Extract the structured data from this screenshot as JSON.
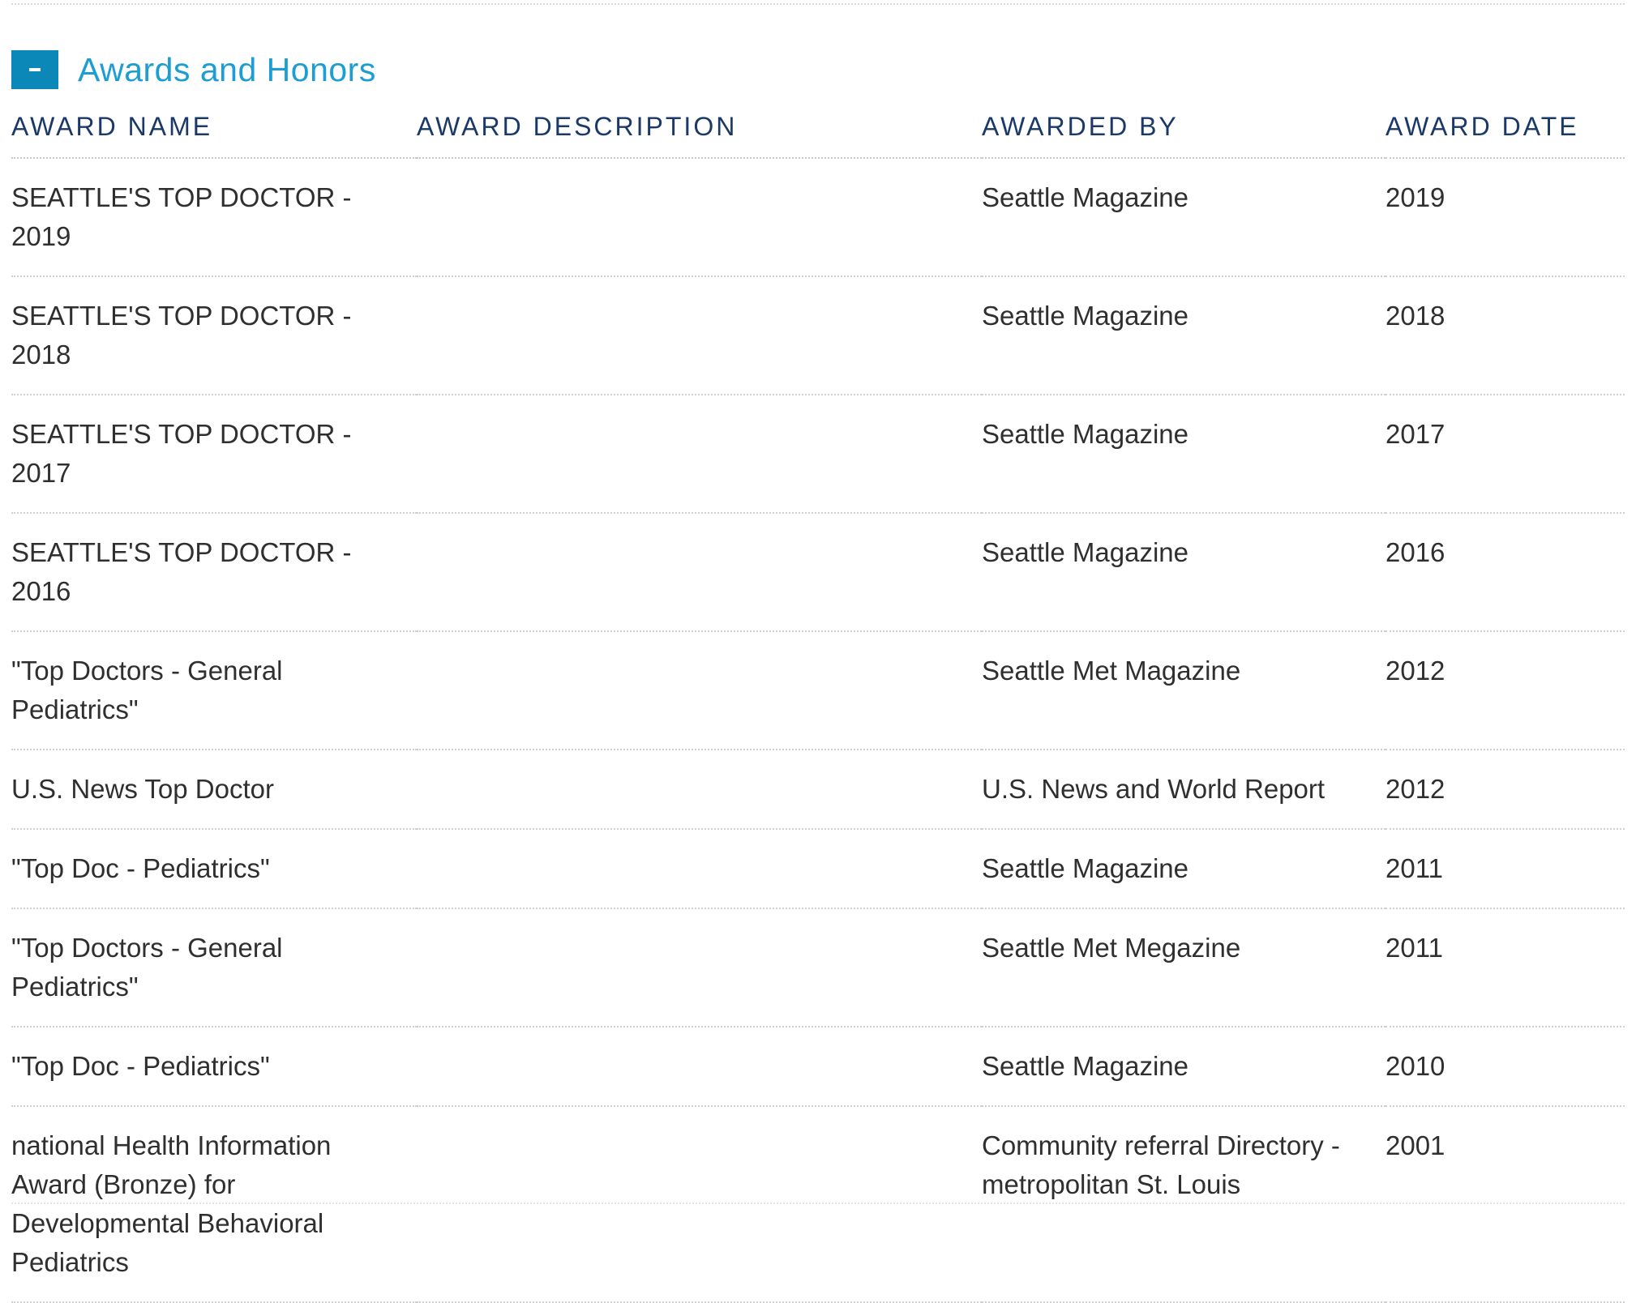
{
  "section": {
    "toggle_label": "-",
    "title": "Awards and Honors"
  },
  "table": {
    "headers": {
      "name": "AWARD NAME",
      "description": "AWARD DESCRIPTION",
      "by": "AWARDED BY",
      "date": "AWARD DATE"
    },
    "rows": [
      {
        "name": "SEATTLE'S TOP DOCTOR - 2019",
        "description": "",
        "by": "Seattle Magazine",
        "date": "2019"
      },
      {
        "name": "SEATTLE'S TOP DOCTOR - 2018",
        "description": "",
        "by": "Seattle Magazine",
        "date": "2018"
      },
      {
        "name": "SEATTLE'S TOP DOCTOR - 2017",
        "description": "",
        "by": "Seattle Magazine",
        "date": "2017"
      },
      {
        "name": "SEATTLE'S TOP DOCTOR - 2016",
        "description": "",
        "by": "Seattle Magazine",
        "date": "2016"
      },
      {
        "name": "\"Top Doctors - General Pediatrics\"",
        "description": "",
        "by": "Seattle Met Magazine",
        "date": "2012"
      },
      {
        "name": "U.S. News Top Doctor",
        "description": "",
        "by": "U.S. News and World Report",
        "date": "2012"
      },
      {
        "name": "\"Top Doc - Pediatrics\"",
        "description": "",
        "by": "Seattle Magazine",
        "date": "2011"
      },
      {
        "name": "\"Top Doctors - General Pediatrics\"",
        "description": "",
        "by": "Seattle Met Megazine",
        "date": "2011"
      },
      {
        "name": "\"Top Doc - Pediatrics\"",
        "description": "",
        "by": "Seattle Magazine",
        "date": "2010"
      },
      {
        "name": "national Health Information Award (Bronze) for Developmental Behavioral Pediatrics",
        "description": "",
        "by": "Community referral Directory - metropolitan St. Louis",
        "date": "2001"
      }
    ]
  },
  "colors": {
    "accent": "#0b87b8",
    "title": "#1c9dd3",
    "header_text": "#1b3968",
    "body_text": "#2f2f2f"
  }
}
